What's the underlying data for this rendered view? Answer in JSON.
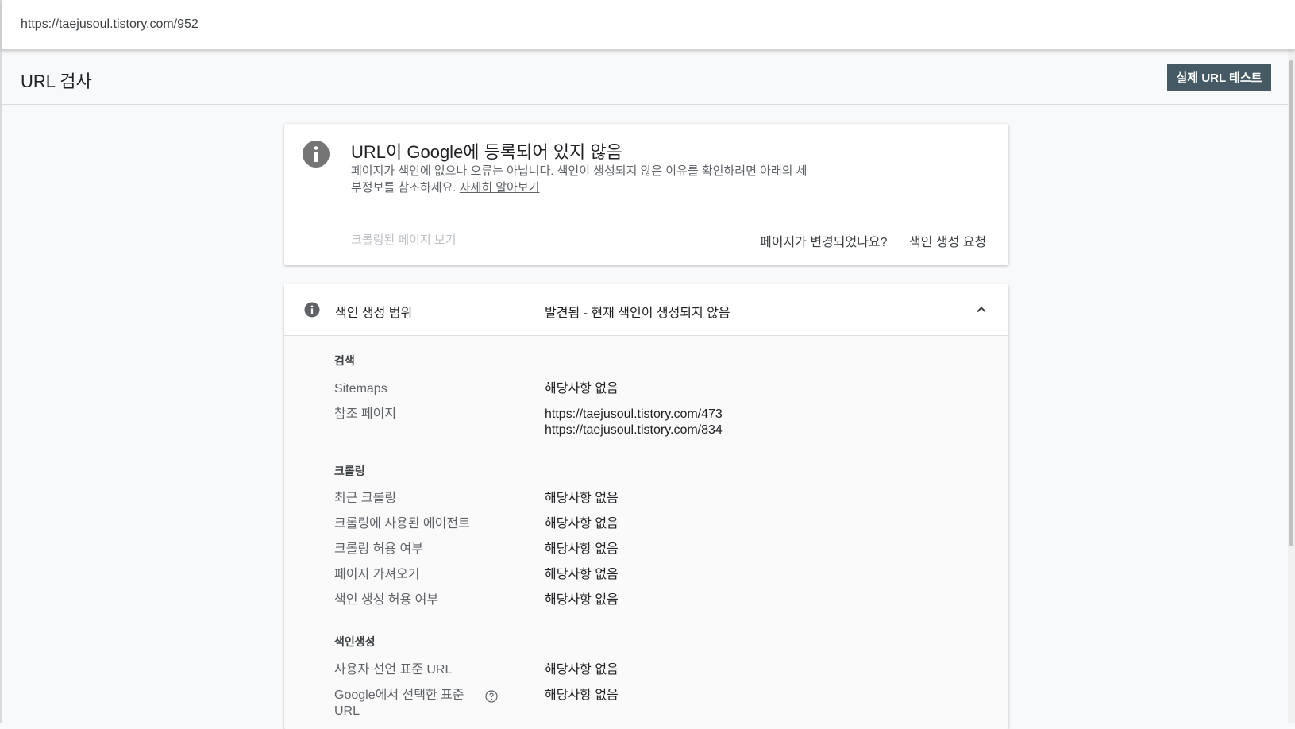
{
  "url_bar": {
    "url": "https://taejusoul.tistory.com/952"
  },
  "header": {
    "title": "URL 검사",
    "test_button_label": "실제 URL 테스트"
  },
  "status_card": {
    "title": "URL이 Google에 등록되어 있지 않음",
    "description": "페이지가 색인에 없으나 오류는 아닙니다. 색인이 생성되지 않은 이유를 확인하려면 아래의 세부정보를 참조하세요.",
    "learn_more": "자세히 알아보기",
    "view_crawled_page": "크롤링된 페이지 보기",
    "page_changed_question": "페이지가 변경되었나요?",
    "request_indexing": "색인 생성 요청"
  },
  "coverage": {
    "label": "색인 생성 범위",
    "value": "발견됨 - 현재 색인이 생성되지 않음",
    "discovery": {
      "heading": "검색",
      "sitemaps_label": "Sitemaps",
      "sitemaps_value": "해당사항 없음",
      "referring_label": "참조 페이지",
      "referring_pages": [
        "https://taejusoul.tistory.com/473",
        "https://taejusoul.tistory.com/834"
      ]
    },
    "crawl": {
      "heading": "크롤링",
      "rows": [
        {
          "label": "최근 크롤링",
          "value": "해당사항 없음"
        },
        {
          "label": "크롤링에 사용된 에이전트",
          "value": "해당사항 없음"
        },
        {
          "label": "크롤링 허용 여부",
          "value": "해당사항 없음"
        },
        {
          "label": "페이지 가져오기",
          "value": "해당사항 없음"
        },
        {
          "label": "색인 생성 허용 여부",
          "value": "해당사항 없음"
        }
      ]
    },
    "indexing": {
      "heading": "색인생성",
      "rows": [
        {
          "label": "사용자 선언 표준 URL",
          "value": "해당사항 없음"
        },
        {
          "label": "Google에서 선택한 표준 URL",
          "value": "해당사항 없음"
        }
      ]
    }
  },
  "colors": {
    "button_bg": "#455a64",
    "info_icon": "#757575",
    "page_bg": "#f8f9fa"
  }
}
